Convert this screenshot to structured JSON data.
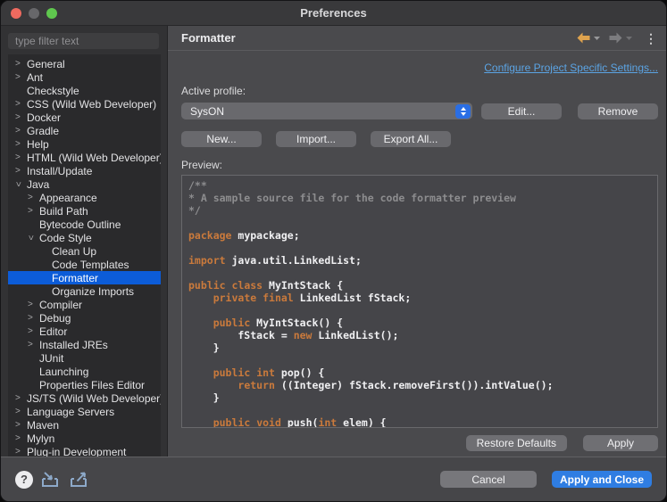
{
  "window": {
    "title": "Preferences"
  },
  "sidebar": {
    "filter_placeholder": "type filter text",
    "tree": [
      {
        "label": "General",
        "level": 0,
        "expand": "collapsed",
        "selected": false
      },
      {
        "label": "Ant",
        "level": 0,
        "expand": "collapsed",
        "selected": false
      },
      {
        "label": "Checkstyle",
        "level": 0,
        "expand": "leaf",
        "selected": false
      },
      {
        "label": "CSS (Wild Web Developer)",
        "level": 0,
        "expand": "collapsed",
        "selected": false
      },
      {
        "label": "Docker",
        "level": 0,
        "expand": "collapsed",
        "selected": false
      },
      {
        "label": "Gradle",
        "level": 0,
        "expand": "collapsed",
        "selected": false
      },
      {
        "label": "Help",
        "level": 0,
        "expand": "collapsed",
        "selected": false
      },
      {
        "label": "HTML (Wild Web Developer)",
        "level": 0,
        "expand": "collapsed",
        "selected": false
      },
      {
        "label": "Install/Update",
        "level": 0,
        "expand": "collapsed",
        "selected": false
      },
      {
        "label": "Java",
        "level": 0,
        "expand": "expanded",
        "selected": false
      },
      {
        "label": "Appearance",
        "level": 1,
        "expand": "collapsed",
        "selected": false
      },
      {
        "label": "Build Path",
        "level": 1,
        "expand": "collapsed",
        "selected": false
      },
      {
        "label": "Bytecode Outline",
        "level": 1,
        "expand": "leaf",
        "selected": false
      },
      {
        "label": "Code Style",
        "level": 1,
        "expand": "expanded",
        "selected": false
      },
      {
        "label": "Clean Up",
        "level": 2,
        "expand": "leaf",
        "selected": false
      },
      {
        "label": "Code Templates",
        "level": 2,
        "expand": "leaf",
        "selected": false
      },
      {
        "label": "Formatter",
        "level": 2,
        "expand": "leaf",
        "selected": true
      },
      {
        "label": "Organize Imports",
        "level": 2,
        "expand": "leaf",
        "selected": false
      },
      {
        "label": "Compiler",
        "level": 1,
        "expand": "collapsed",
        "selected": false
      },
      {
        "label": "Debug",
        "level": 1,
        "expand": "collapsed",
        "selected": false
      },
      {
        "label": "Editor",
        "level": 1,
        "expand": "collapsed",
        "selected": false
      },
      {
        "label": "Installed JREs",
        "level": 1,
        "expand": "collapsed",
        "selected": false
      },
      {
        "label": "JUnit",
        "level": 1,
        "expand": "leaf",
        "selected": false
      },
      {
        "label": "Launching",
        "level": 1,
        "expand": "leaf",
        "selected": false
      },
      {
        "label": "Properties Files Editor",
        "level": 1,
        "expand": "leaf",
        "selected": false
      },
      {
        "label": "JS/TS (Wild Web Developer)",
        "level": 0,
        "expand": "collapsed",
        "selected": false
      },
      {
        "label": "Language Servers",
        "level": 0,
        "expand": "collapsed",
        "selected": false
      },
      {
        "label": "Maven",
        "level": 0,
        "expand": "collapsed",
        "selected": false
      },
      {
        "label": "Mylyn",
        "level": 0,
        "expand": "collapsed",
        "selected": false
      },
      {
        "label": "Plug-in Development",
        "level": 0,
        "expand": "collapsed",
        "selected": false
      }
    ]
  },
  "header": {
    "title": "Formatter",
    "menu_dots": "⋮"
  },
  "main": {
    "link": "Configure Project Specific Settings...",
    "active_profile_label": "Active profile:",
    "profile_select_value": "SysON",
    "buttons": {
      "edit": "Edit...",
      "remove": "Remove",
      "new": "New...",
      "import": "Import...",
      "export_all": "Export All...",
      "restore_defaults": "Restore Defaults",
      "apply": "Apply"
    },
    "preview_label": "Preview:",
    "code_lines": [
      [
        [
          "c",
          "/**"
        ]
      ],
      [
        [
          "c",
          "* A sample source file for the code formatter preview"
        ]
      ],
      [
        [
          "c",
          "*/"
        ]
      ],
      [],
      [
        [
          "k",
          "package"
        ],
        [
          "p",
          " mypackage;"
        ]
      ],
      [],
      [
        [
          "k",
          "import"
        ],
        [
          "p",
          " java.util.LinkedList;"
        ]
      ],
      [],
      [
        [
          "k",
          "public"
        ],
        [
          "p",
          " "
        ],
        [
          "k",
          "class"
        ],
        [
          "p",
          " MyIntStack {"
        ]
      ],
      [
        [
          "p",
          "    "
        ],
        [
          "k",
          "private"
        ],
        [
          "p",
          " "
        ],
        [
          "k",
          "final"
        ],
        [
          "p",
          " LinkedList fStack;"
        ]
      ],
      [],
      [
        [
          "p",
          "    "
        ],
        [
          "k",
          "public"
        ],
        [
          "p",
          " MyIntStack() {"
        ]
      ],
      [
        [
          "p",
          "        fStack = "
        ],
        [
          "k",
          "new"
        ],
        [
          "p",
          " LinkedList();"
        ]
      ],
      [
        [
          "p",
          "    }"
        ]
      ],
      [],
      [
        [
          "p",
          "    "
        ],
        [
          "k",
          "public"
        ],
        [
          "p",
          " "
        ],
        [
          "k",
          "int"
        ],
        [
          "p",
          " pop() {"
        ]
      ],
      [
        [
          "p",
          "        "
        ],
        [
          "k",
          "return"
        ],
        [
          "p",
          " ((Integer) fStack.removeFirst()).intValue();"
        ]
      ],
      [
        [
          "p",
          "    }"
        ]
      ],
      [],
      [
        [
          "p",
          "    "
        ],
        [
          "k",
          "public"
        ],
        [
          "p",
          " "
        ],
        [
          "k",
          "void"
        ],
        [
          "p",
          " push("
        ],
        [
          "k",
          "int"
        ],
        [
          "p",
          " elem) {"
        ]
      ]
    ]
  },
  "footer": {
    "help_glyph": "?",
    "cancel": "Cancel",
    "apply_and_close": "Apply and Close"
  },
  "colors": {
    "selection_blue": "#0c5cd8",
    "accent_blue": "#2f7de2",
    "stepper_blue": "#2a6ee4",
    "link_blue": "#5ba4e4",
    "keyword_orange": "#ca7a3c",
    "comment_gray": "#8d8d8f",
    "back_arrow_orange": "#dda24e",
    "traffic_red": "#ee6a5f",
    "traffic_gray": "#67676a",
    "traffic_green": "#5fc74e"
  }
}
